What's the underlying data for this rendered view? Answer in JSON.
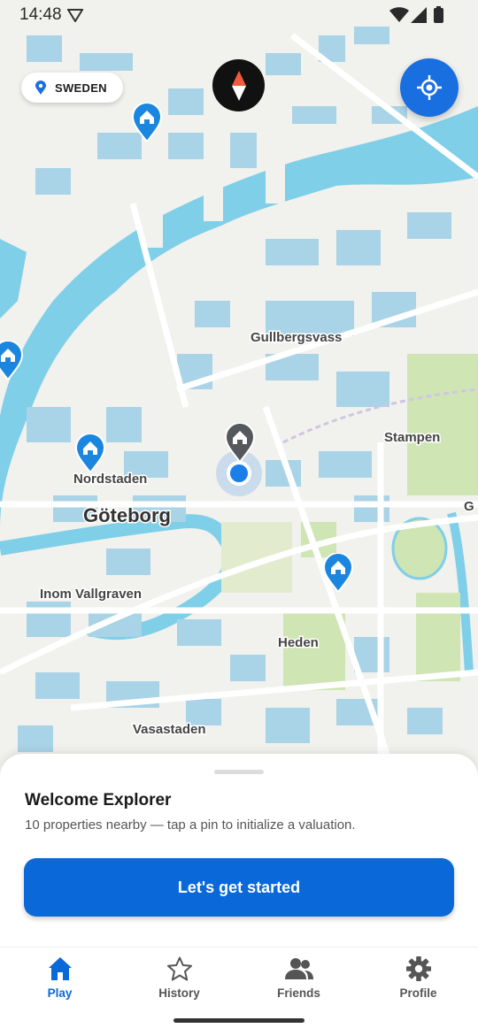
{
  "status_bar": {
    "time": "14:48"
  },
  "location_chip": {
    "label": "SWEDEN"
  },
  "map": {
    "labels": {
      "gullbergsvass": "Gullbergsvass",
      "stampen": "Stampen",
      "nordstaden": "Nordstaden",
      "goteborg": "Göteborg",
      "inom_vallgraven": "Inom Vallgraven",
      "heden": "Heden",
      "vasastaden": "Vasastaden",
      "edge_g": "G"
    },
    "property_pin_count": 5
  },
  "sheet": {
    "title": "Welcome Explorer",
    "subtitle": "10 properties nearby — tap a pin to initialize a valuation.",
    "cta_label": "Let's get started"
  },
  "bottom_nav": {
    "items": [
      {
        "label": "Play",
        "icon": "home-icon",
        "active": true
      },
      {
        "label": "History",
        "icon": "star-icon",
        "active": false
      },
      {
        "label": "Friends",
        "icon": "people-icon",
        "active": false
      },
      {
        "label": "Profile",
        "icon": "gear-icon",
        "active": false
      }
    ]
  },
  "colors": {
    "accent": "#0a68d8",
    "water": "#7fcfe8",
    "park": "#cfe5b4",
    "land": "#f2f2ee"
  }
}
